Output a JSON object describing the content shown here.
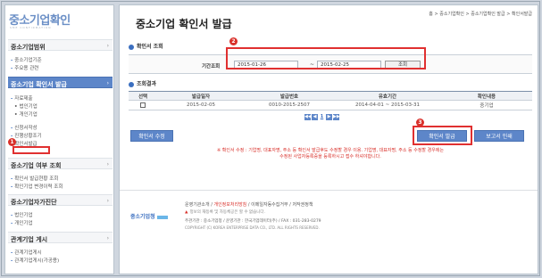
{
  "sidebar": {
    "logo": "중소기업확인",
    "logo_sub": "SME CONFIRMATION",
    "sections": [
      {
        "label": "중소기업범위",
        "arrow": "›"
      },
      {
        "label": "중소기업 확인서 발급",
        "arrow": "›"
      },
      {
        "label": "중소기업 여부 조회",
        "arrow": "›"
      },
      {
        "label": "중소기업자가진단",
        "arrow": "›"
      },
      {
        "label": "관계기업 게시",
        "arrow": "›"
      }
    ],
    "range_items": [
      "중소기업기준",
      "주요용 관련"
    ],
    "issue_items": [
      "자료제출",
      "법인기업",
      "개인기업",
      "신청서작성",
      "진행상황조기",
      "확인서발급"
    ],
    "check_items": [
      "확인서 발급현황 조회",
      "확인기업 변경이력 조회"
    ],
    "self_items": [
      "법인기업",
      "개인기업"
    ],
    "relation_items": [
      "관계기업게시",
      "관계기업게시(가공용)"
    ]
  },
  "markers": {
    "m1": "1",
    "m2": "2",
    "m3": "3"
  },
  "main": {
    "title": "중소기업 확인서 발급",
    "breadcrumb": "홈 > 중소기업확인 > 중소기업확인 발급 > 확인서발급",
    "search": {
      "header": "확인서 조회",
      "label": "기간조회",
      "from": "2015-01-26",
      "tilde": "~",
      "to": "2015-02-25",
      "button": "조회"
    },
    "results": {
      "header": "조회결과",
      "columns": [
        "선택",
        "발급일자",
        "발급번호",
        "유효기간",
        "확인내용"
      ],
      "rows": [
        {
          "date": "2015-02-05",
          "number": "0010-2015-2507",
          "valid": "2014-04-01 ~ 2015-03-31",
          "content": "중기업"
        }
      ]
    },
    "pager": {
      "first": "◀◀",
      "prev": "◀",
      "page": "1",
      "next": "▶",
      "last": "▶▶"
    },
    "buttons": {
      "modify": "확인서 수정",
      "issue": "확인서 발급",
      "print": "보고서 인쇄"
    },
    "notice_line1": "※ 확인서 수정 : 기업명, 대표자명, 주소 등 확인서 발급후도 수정할 경우 이용. 기업명, 대표자명, 주소 등 수정할 경우에는",
    "notice_line2": "수정된 사업자등록증을 등록하시고 접수 하셔야합니다."
  },
  "footer": {
    "logo": "중소기업청",
    "links": [
      "운영기관소개",
      "개인정보처리방침",
      "이메일자동수집거부",
      "저작권정책"
    ],
    "warn": "정보의 재등록 및 자동체공은 할 수 없습니다.",
    "address": "주관기관 : 중소기업청 / 운영기관 : 한국기업데이터(주) / FAX : 031-283-0279",
    "copyright": "COPYRIGHT (C) KOREA ENTERPRISE DATA CO., LTD. ALL RIGHTS RESERVED."
  }
}
